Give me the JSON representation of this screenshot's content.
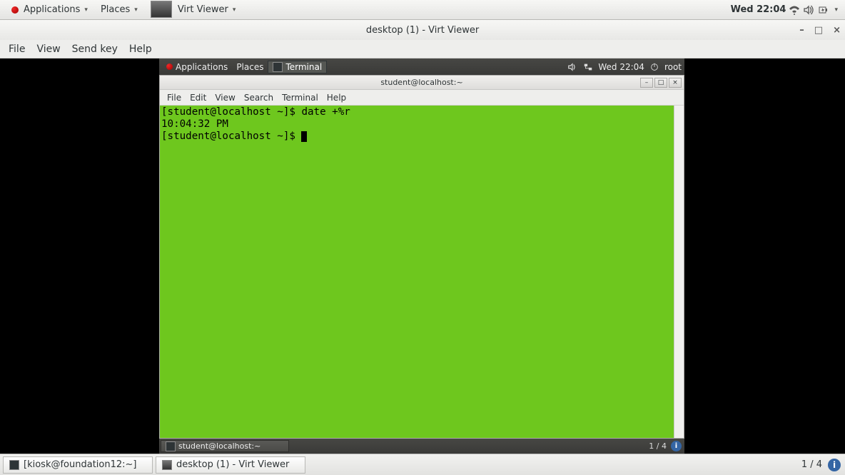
{
  "outer_top": {
    "applications": "Applications",
    "places": "Places",
    "app_name": "Virt Viewer",
    "clock": "Wed 22:04"
  },
  "virt_viewer": {
    "title": "desktop (1) - Virt Viewer",
    "menus": {
      "file": "File",
      "view": "View",
      "sendkey": "Send key",
      "help": "Help"
    },
    "controls": {
      "min": "–",
      "max": "□",
      "close": "×"
    }
  },
  "guest_top": {
    "applications": "Applications",
    "places": "Places",
    "task_terminal": "Terminal",
    "clock": "Wed 22:04",
    "user": "root"
  },
  "terminal": {
    "title": "student@localhost:~",
    "menus": {
      "file": "File",
      "edit": "Edit",
      "view": "View",
      "search": "Search",
      "terminal": "Terminal",
      "help": "Help"
    },
    "controls": {
      "min": "–",
      "max": "□",
      "close": "×"
    },
    "line1_prompt": "[student@localhost ~]$ ",
    "line1_cmd": "date +%r",
    "line2": "10:04:32 PM",
    "line3_prompt": "[student@localhost ~]$ "
  },
  "guest_bottom": {
    "task_label": "student@localhost:~",
    "workspace": "1 / 4"
  },
  "outer_bottom": {
    "task1": "[kiosk@foundation12:~]",
    "task2": "desktop (1) - Virt Viewer",
    "workspace": "1 / 4"
  }
}
